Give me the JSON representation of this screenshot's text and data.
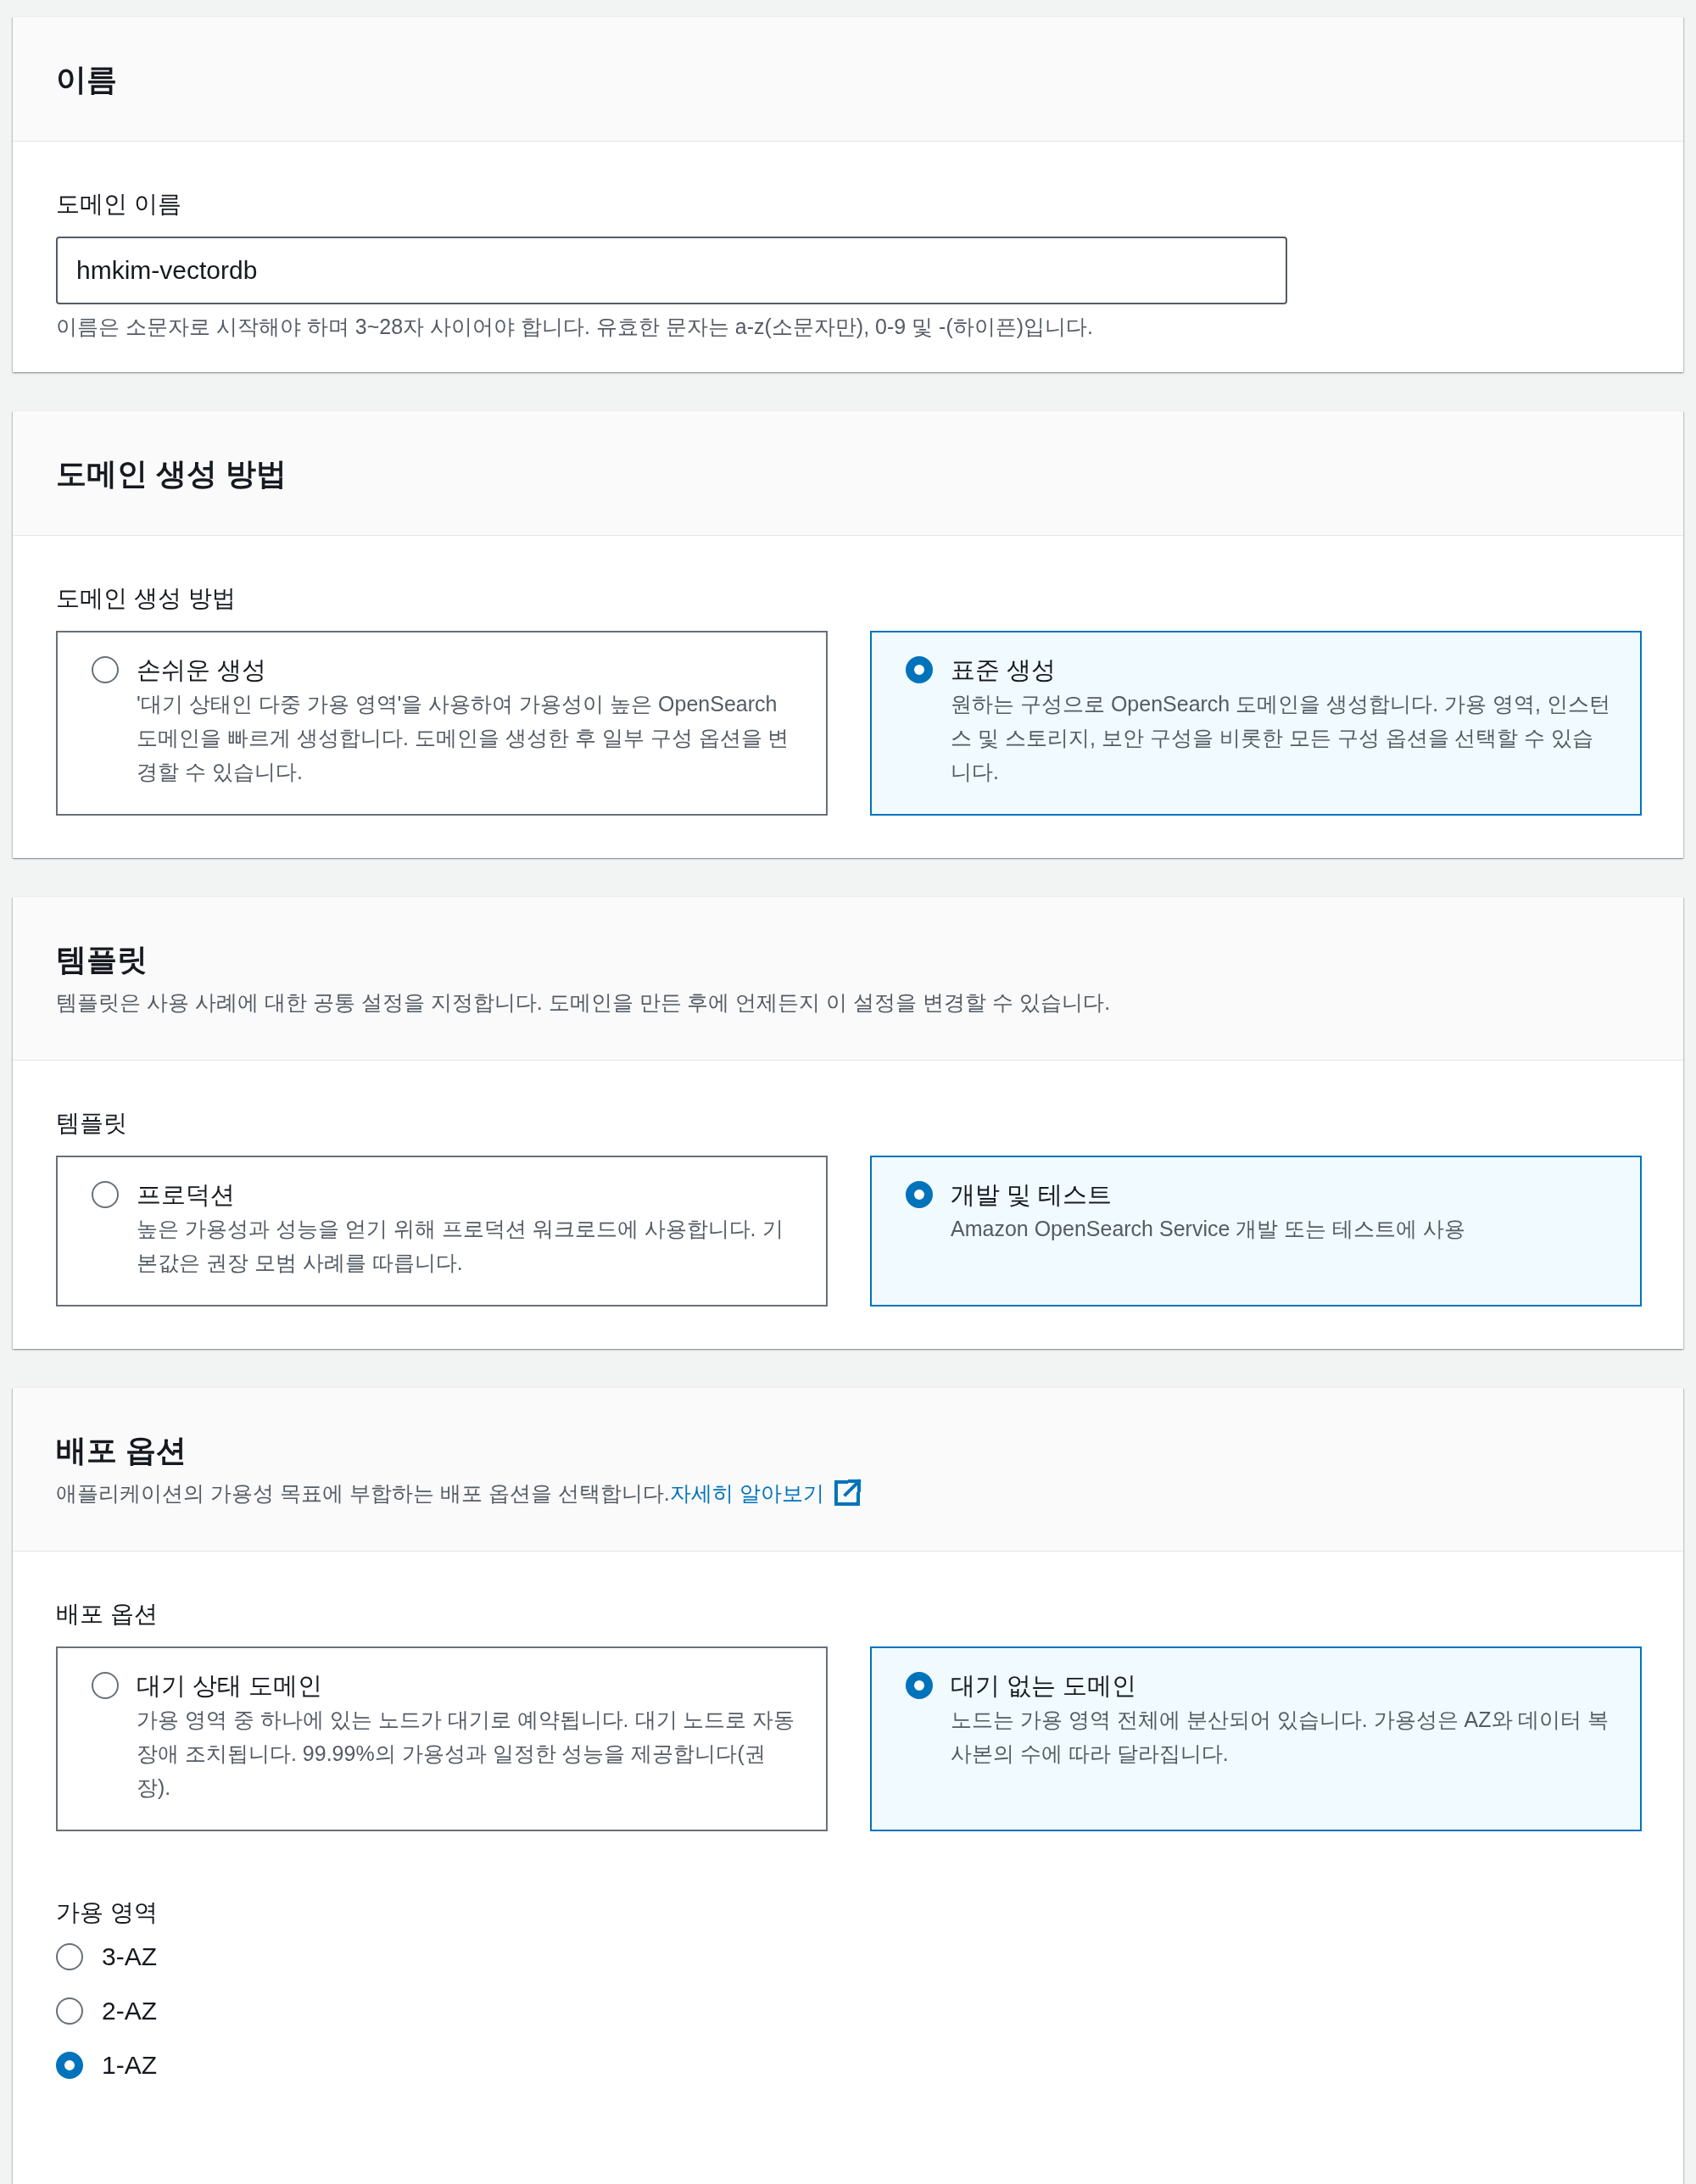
{
  "sections": [
    {
      "title": "이름",
      "fields": [
        {
          "kind": "text_input",
          "label": "도메인 이름",
          "value": "hmkim-vectordb",
          "hint": "이름은 소문자로 시작해야 하며 3~28자 사이어야 합니다. 유효한 문자는 a-z(소문자만), 0-9 및 -(하이픈)입니다."
        }
      ]
    },
    {
      "title": "도메인 생성 방법",
      "fields": [
        {
          "kind": "tiles",
          "label": "도메인 생성 방법",
          "options": [
            {
              "title": "손쉬운 생성",
              "description": "'대기 상태인 다중 가용 영역'을 사용하여 가용성이 높은 OpenSearch 도메인을 빠르게 생성합니다. 도메인을 생성한 후 일부 구성 옵션을 변경할 수 있습니다.",
              "selected": false
            },
            {
              "title": "표준 생성",
              "description": "원하는 구성으로 OpenSearch 도메인을 생성합니다. 가용 영역, 인스턴스 및 스토리지, 보안 구성을 비롯한 모든 구성 옵션을 선택할 수 있습니다.",
              "selected": true
            }
          ]
        }
      ]
    },
    {
      "title": "템플릿",
      "description": "템플릿은 사용 사례에 대한 공통 설정을 지정합니다. 도메인을 만든 후에 언제든지 이 설정을 변경할 수 있습니다.",
      "fields": [
        {
          "kind": "tiles",
          "label": "템플릿",
          "options": [
            {
              "title": "프로덕션",
              "description": "높은 가용성과 성능을 얻기 위해 프로덕션 워크로드에 사용합니다. 기본값은 권장 모범 사례를 따릅니다.",
              "selected": false
            },
            {
              "title": "개발 및 테스트",
              "description": "Amazon OpenSearch Service 개발 또는 테스트에 사용",
              "selected": true
            }
          ]
        }
      ]
    },
    {
      "title": "배포 옵션",
      "description": "애플리케이션의 가용성 목표에 부합하는 배포 옵션을 선택합니다.",
      "link": "자세히 알아보기",
      "fields": [
        {
          "kind": "tiles",
          "label": "배포 옵션",
          "options": [
            {
              "title": "대기 상태 도메인",
              "description": "가용 영역 중 하나에 있는 노드가 대기로 예약됩니다. 대기 노드로 자동 장애 조치됩니다. 99.99%의 가용성과 일정한 성능을 제공합니다(권장).",
              "selected": false
            },
            {
              "title": "대기 없는 도메인",
              "description": "노드는 가용 영역 전체에 분산되어 있습니다. 가용성은 AZ와 데이터 복사본의 수에 따라 달라집니다.",
              "selected": true
            }
          ]
        },
        {
          "kind": "radio_list",
          "label": "가용 영역",
          "options": [
            {
              "label": "3-AZ",
              "selected": false
            },
            {
              "label": "2-AZ",
              "selected": false
            },
            {
              "label": "1-AZ",
              "selected": true
            }
          ]
        }
      ]
    }
  ]
}
